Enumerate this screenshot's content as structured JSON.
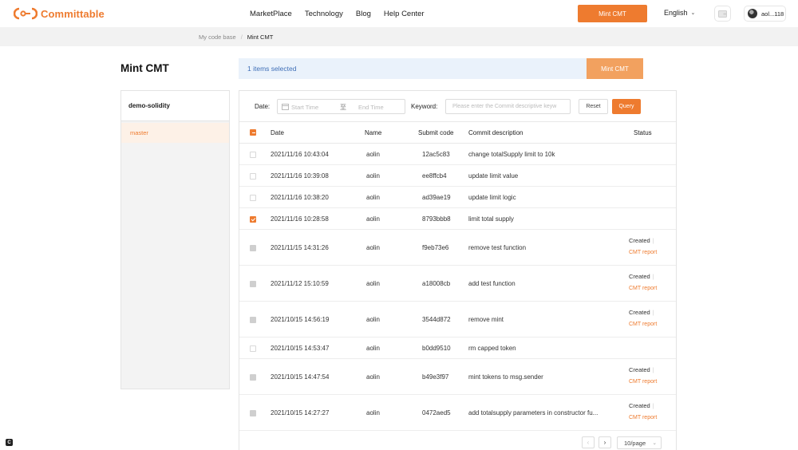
{
  "header": {
    "logo_text": "Committable",
    "nav": [
      "MarketPlace",
      "Technology",
      "Blog",
      "Help Center"
    ],
    "mint_button": "Mint CMT",
    "language": "English",
    "user": "aol...118"
  },
  "breadcrumb": {
    "root": "My code base",
    "separator": "/",
    "current": "Mint CMT"
  },
  "page": {
    "title": "Mint CMT",
    "selection_text": "1 items selected",
    "mint_button": "Mint CMT"
  },
  "sidebar": {
    "repo": "demo-solidity",
    "branches": [
      {
        "label": "master"
      }
    ]
  },
  "filters": {
    "date_label": "Date:",
    "start_placeholder": "Start Time",
    "range_separator": "至",
    "end_placeholder": "End Time",
    "keyword_label": "Keyword:",
    "keyword_placeholder": "Please enter the Commit descriptive keyw",
    "reset": "Reset",
    "query": "Query"
  },
  "table": {
    "columns": [
      "Date",
      "Name",
      "Submit code",
      "Commit description",
      "Status"
    ],
    "status_created": "Created",
    "status_link": "CMT report",
    "rows": [
      {
        "date": "2021/11/16 10:43:04",
        "name": "aolin",
        "code": "12ac5c83",
        "desc": "change totalSupply limit to 10k",
        "checkbox": "empty"
      },
      {
        "date": "2021/11/16 10:39:08",
        "name": "aolin",
        "code": "ee8ffcb4",
        "desc": "update limit value",
        "checkbox": "empty"
      },
      {
        "date": "2021/11/16 10:38:20",
        "name": "aolin",
        "code": "ad39ae19",
        "desc": "update limit logic",
        "checkbox": "empty"
      },
      {
        "date": "2021/11/16 10:28:58",
        "name": "aolin",
        "code": "8793bbb8",
        "desc": "limit total supply",
        "checkbox": "checked"
      },
      {
        "date": "2021/11/15 14:31:26",
        "name": "aolin",
        "code": "f9eb73e6",
        "desc": "remove test function",
        "checkbox": "disabled",
        "created": true
      },
      {
        "date": "2021/11/12 15:10:59",
        "name": "aolin",
        "code": "a18008cb",
        "desc": "add test function",
        "checkbox": "disabled",
        "created": true
      },
      {
        "date": "2021/10/15 14:56:19",
        "name": "aolin",
        "code": "3544d872",
        "desc": "remove mint",
        "checkbox": "disabled",
        "created": true
      },
      {
        "date": "2021/10/15 14:53:47",
        "name": "aolin",
        "code": "b0dd9510",
        "desc": "rm capped token",
        "checkbox": "empty"
      },
      {
        "date": "2021/10/15 14:47:54",
        "name": "aolin",
        "code": "b49e3f97",
        "desc": "mint tokens to msg.sender",
        "checkbox": "disabled",
        "created": true
      },
      {
        "date": "2021/10/15 14:27:27",
        "name": "aolin",
        "code": "0472aed5",
        "desc": "add totalsupply parameters in constructor fu...",
        "checkbox": "disabled",
        "created": true
      }
    ]
  },
  "pagination": {
    "prev": "‹",
    "next": "›",
    "page_size": "10/page"
  },
  "colors": {
    "accent": "#ee7b2f",
    "selection_bg": "#eaf2fb",
    "selection_text": "#3f6fb7"
  }
}
